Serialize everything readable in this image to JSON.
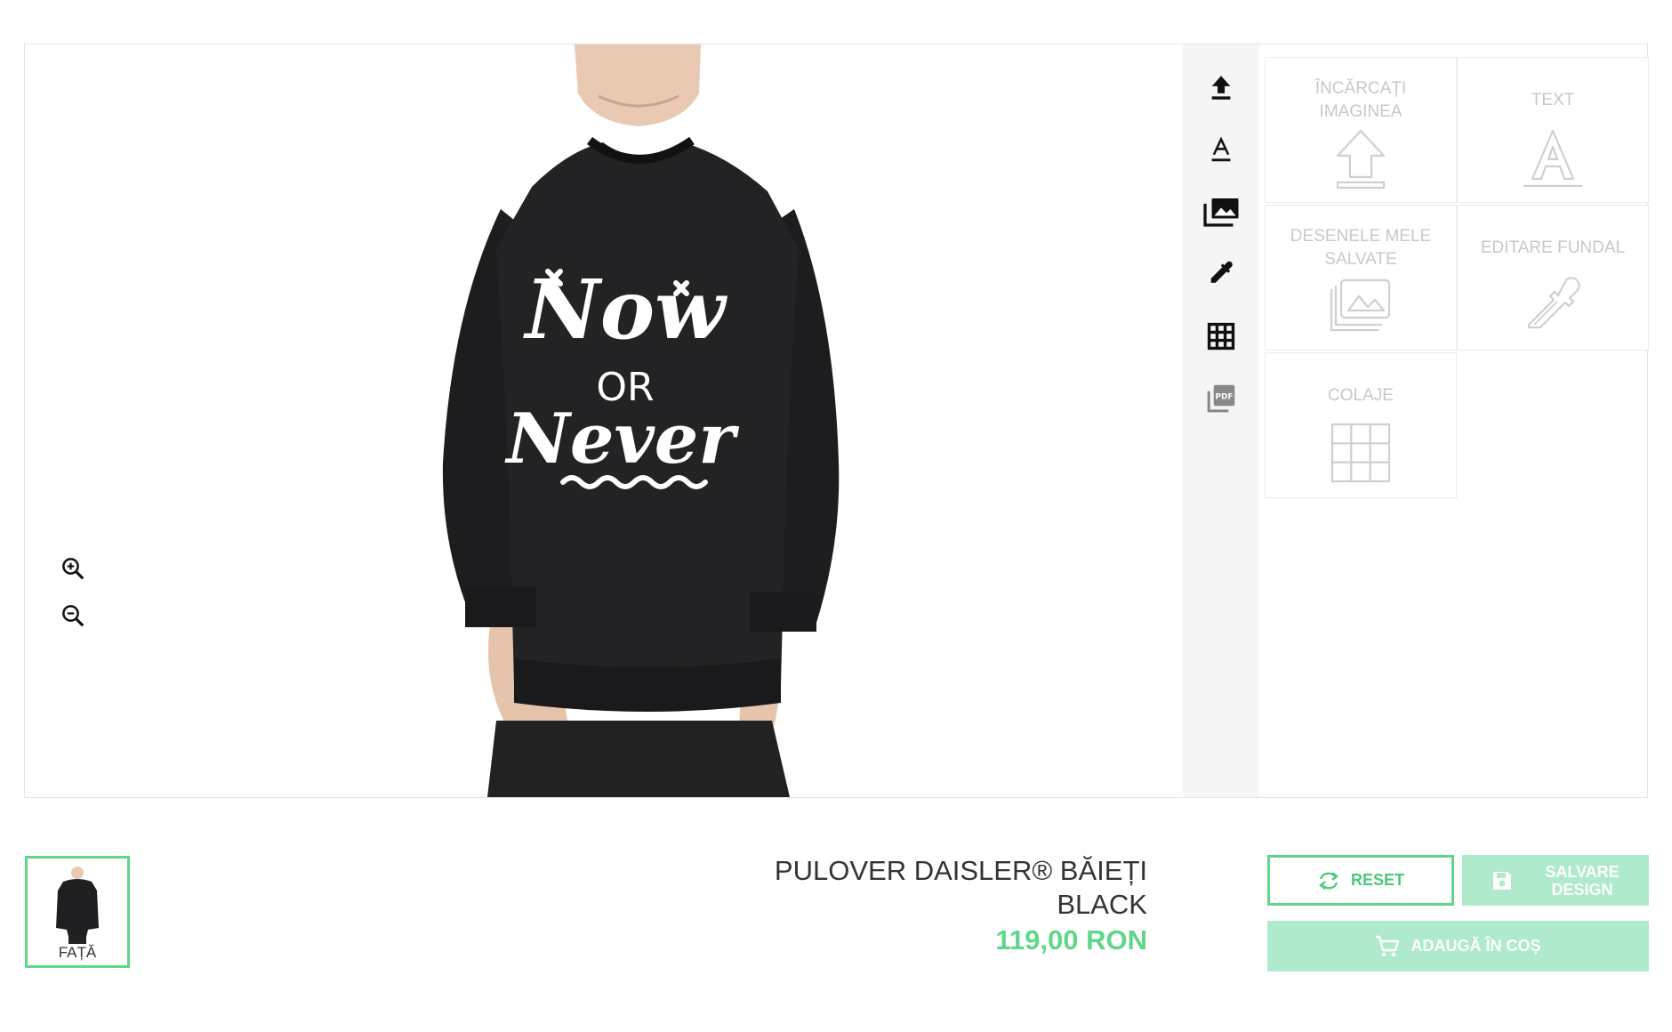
{
  "tools": {
    "upload_label": "ÎNCĂRCAȚI IMAGINEA",
    "text_label": "TEXT",
    "saved_label": "DESENELE MELE SALVATE",
    "background_label": "EDITARE FUNDAL",
    "collage_label": "COLAJE"
  },
  "rail": {
    "icons": [
      "upload-icon",
      "text-icon",
      "gallery-icon",
      "eyedropper-icon",
      "grid-icon",
      "pdf-icon"
    ]
  },
  "zoom": {
    "icons": [
      "zoom-in-icon",
      "zoom-out-icon"
    ]
  },
  "design": {
    "lines": [
      "Now",
      "OR",
      "Never"
    ]
  },
  "thumbnails": [
    {
      "label": "FAȚĂ",
      "selected": true
    }
  ],
  "product": {
    "title_line1": "PULOVER DAISLER® BĂIEȚI",
    "title_line2": "BLACK",
    "price": "119,00 RON"
  },
  "actions": {
    "reset_label": "RESET",
    "save_label_line1": "SALVARE",
    "save_label_line2": "DESIGN",
    "cart_label": "ADAUGĂ ÎN COȘ"
  },
  "colors": {
    "accent": "#5fd68a",
    "accent_light": "#aeeacb",
    "tile_text": "#c8c8c8",
    "rail_bg": "#f5f5f5"
  }
}
